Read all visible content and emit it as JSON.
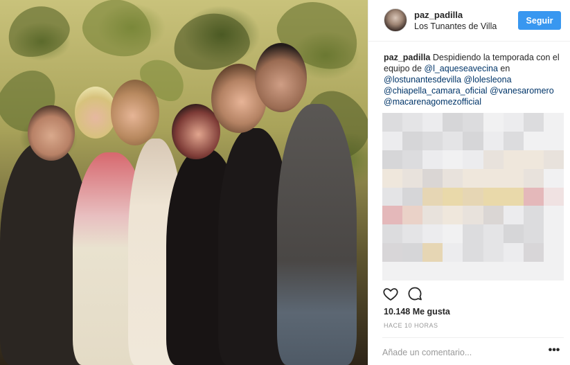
{
  "post": {
    "author": "paz_padilla",
    "location": "Los Tunantes de Villa",
    "follow_label": "Seguir"
  },
  "caption": {
    "author": "paz_padilla",
    "text_1": "Despidiendo la temporada con el equipo de ",
    "tags": [
      "@l_aqueseavecina",
      "@lostunantesdevilla",
      "@lolesleona",
      "@chiapella_camara_oficial",
      "@vanesaromero",
      "@macarenagomezofficial"
    ]
  },
  "actions": {
    "like_icon": "heart-icon",
    "comment_icon": "comment-bubble-icon"
  },
  "likes_text": "10.148 Me gusta",
  "time_text": "HACE 10 HORAS",
  "comment": {
    "placeholder": "Añade un comentario...",
    "more_label": "•••"
  },
  "colors": {
    "accent": "#3897f0",
    "tag": "#003569",
    "muted": "#999999"
  }
}
